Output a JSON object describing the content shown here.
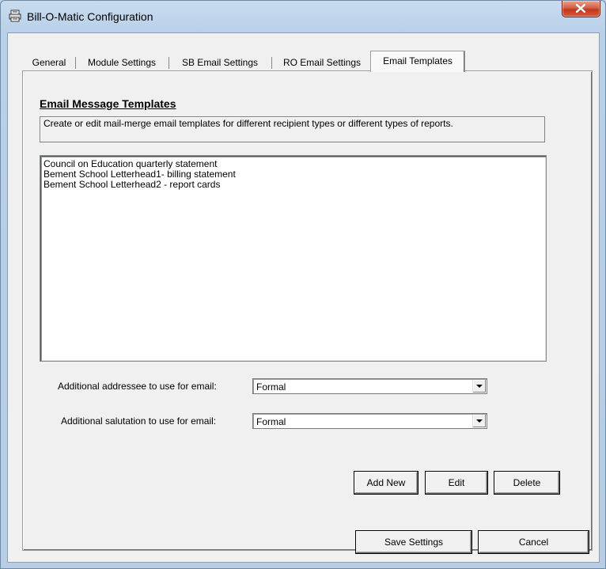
{
  "window": {
    "title": "Bill-O-Matic Configuration"
  },
  "tabs": [
    {
      "label": "General"
    },
    {
      "label": "Module Settings"
    },
    {
      "label": "SB Email Settings"
    },
    {
      "label": "RO Email Settings"
    },
    {
      "label": "Email Templates",
      "active": true
    }
  ],
  "email_templates": {
    "section_title": "Email Message Templates",
    "description": "Create or edit mail-merge email templates for different recipient types or different types of reports.",
    "templates": [
      "Council on Education quarterly statement",
      "Bement School Letterhead1- billing statement",
      "Bement School Letterhead2 - report cards"
    ],
    "addressee_label": "Additional addressee to use for email:",
    "addressee_value": "Formal",
    "salutation_label": "Additional salutation to use for email:",
    "salutation_value": "Formal",
    "buttons": {
      "add_new": "Add New",
      "edit": "Edit",
      "delete": "Delete"
    }
  },
  "footer": {
    "save": "Save Settings",
    "cancel": "Cancel"
  }
}
